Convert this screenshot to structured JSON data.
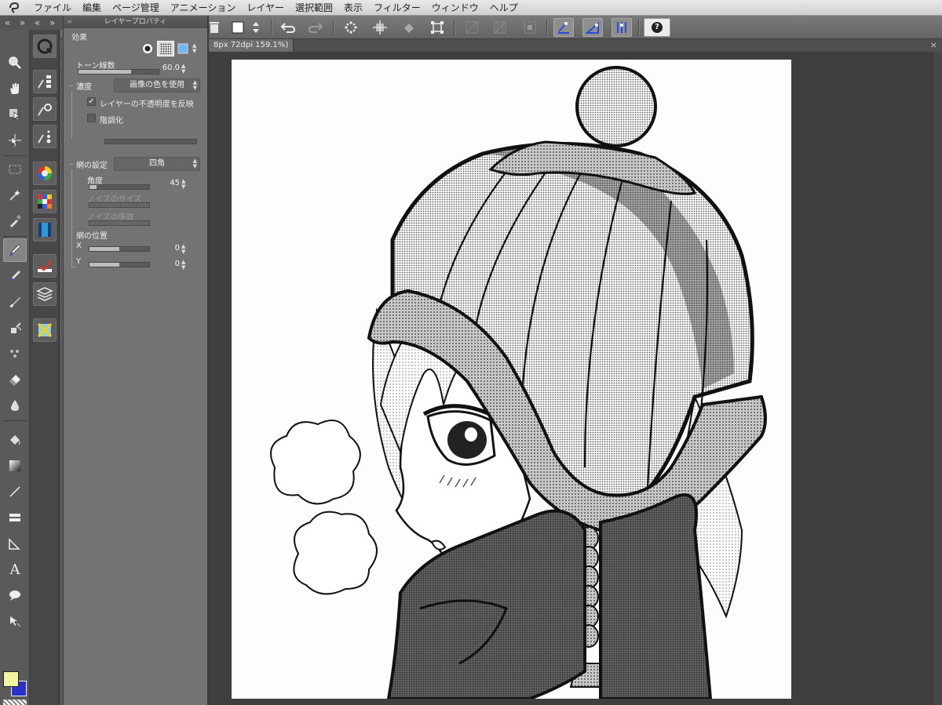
{
  "menubar": {
    "items": [
      "ファイル",
      "編集",
      "ページ管理",
      "アニメーション",
      "レイヤー",
      "選択範囲",
      "表示",
      "フィルター",
      "ウィンドウ",
      "ヘルプ"
    ]
  },
  "collapse_strip": {
    "left": "«",
    "right": "»",
    "expand": "«"
  },
  "document": {
    "tab_label": "8px 72dpi 159.1%)",
    "close": "×"
  },
  "panel": {
    "title": "レイヤープロパティ",
    "effect_label": "効果",
    "tone_lines_label": "トーン線数",
    "tone_lines_value": "60.0",
    "tone_lines_level": 0.66,
    "density_label": "濃度",
    "density_option": "画像の色を使用",
    "reflect_opacity_label": "レイヤーの不透明度を反映",
    "reflect_opacity_checked": true,
    "posterize_label": "階調化",
    "posterize_checked": false,
    "halftone_label": "網の設定",
    "halftone_option": "四角",
    "angle_label": "角度",
    "angle_value": "45",
    "angle_level": 0.12,
    "noise_size_label": "ノイズのサイズ",
    "noise_factor_label": "ノイズの係数",
    "position_label": "網の位置",
    "x_label": "X",
    "x_value": "0",
    "x_level": 0.5,
    "y_label": "Y",
    "y_value": "0",
    "y_level": 0.5
  },
  "colors": {
    "main_color": "#f2f5a0",
    "sub_color": "#2a31c9"
  },
  "help": {
    "label": "?"
  }
}
